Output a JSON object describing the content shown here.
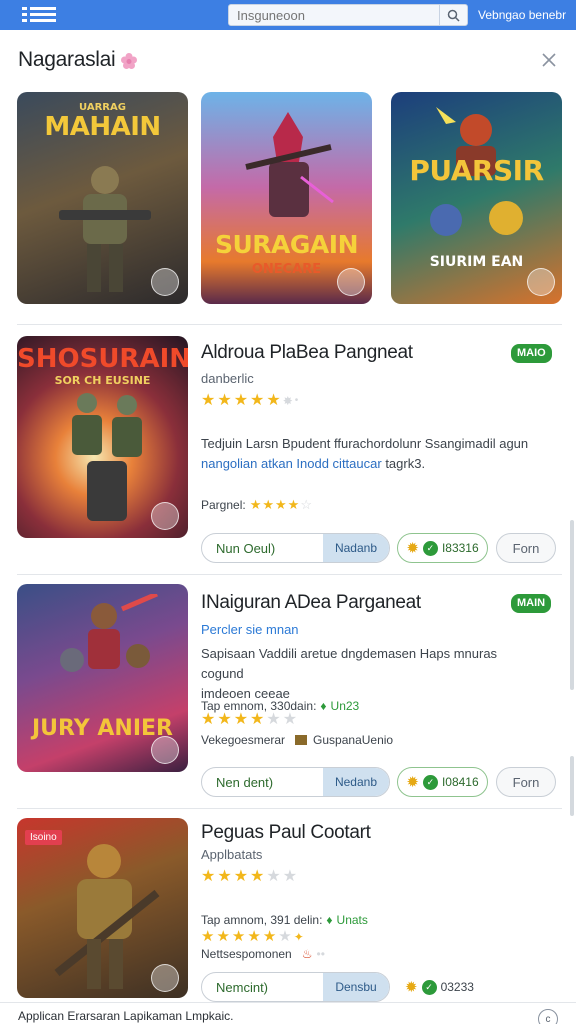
{
  "search": {
    "placeholder": "Insguneoon"
  },
  "topbar": {
    "link_label": "Vebngao benebr"
  },
  "header": {
    "title": "Nagaraslai"
  },
  "featured": [
    {
      "title": "MAHAIN",
      "subtitle": "UARRAG"
    },
    {
      "title": "SURAGAIN",
      "subtitle": "ONECARE"
    },
    {
      "title": "PUARSIR",
      "subtitle": "SIURIM EAN"
    }
  ],
  "items": [
    {
      "thumb_title": "SHOSURAIN",
      "thumb_subtitle": "SOR CH EUSINE",
      "title": "Aldroua PlaBea Pangneat",
      "tag": "MAIO",
      "subtitle": "danberlic",
      "rating": 4.5,
      "desc_line1": "Tedjuin Larsn Bpudent ffurachordolunr Ssangimadil agun",
      "desc_line2": "nangolian atkan Inodd cittaucar",
      "desc_line2_tail": "tagrk3.",
      "meta_label": "Pargnel:",
      "meta_rating": 4,
      "left_label": "Nun Oeul)",
      "right_label": "Nadanb",
      "score": "I83316",
      "form_label": "Forn"
    },
    {
      "thumb_title": "JURY ANIER",
      "title": "INaiguran ADea Parganeat",
      "tag": "MAIN",
      "subtitle": "Percler sie mnan",
      "rating": 4,
      "desc_line1": "Sapisaan Vaddili aretue dngdemasen Haps mnuras cogund",
      "desc_line2": "imdeoen ceeae",
      "meta_label": "Tap emnom, 330dain:",
      "meta_green": "Un23",
      "meta2_label": "Vekegoesmerar",
      "meta2_value": "GuspanaUenio",
      "left_label": "Nen dent)",
      "right_label": "Nedanb",
      "score": "I08416",
      "form_label": "Forn"
    },
    {
      "thumb_badge": "Isoino",
      "title": "Peguas Paul Cootart",
      "subtitle": "Applbatats",
      "rating": 3.5,
      "meta_label": "Tap amnom, 391 delin:",
      "meta_green": "Unats",
      "meta_rating": 4.5,
      "meta2_label": "Nettsespomonen",
      "left_label": "Nemcint)",
      "right_label": "Densbu",
      "score": "03233"
    }
  ],
  "footer": {
    "text": "Applican Erarsaran Lapikaman Lmpkaic.",
    "button_label": "c"
  }
}
